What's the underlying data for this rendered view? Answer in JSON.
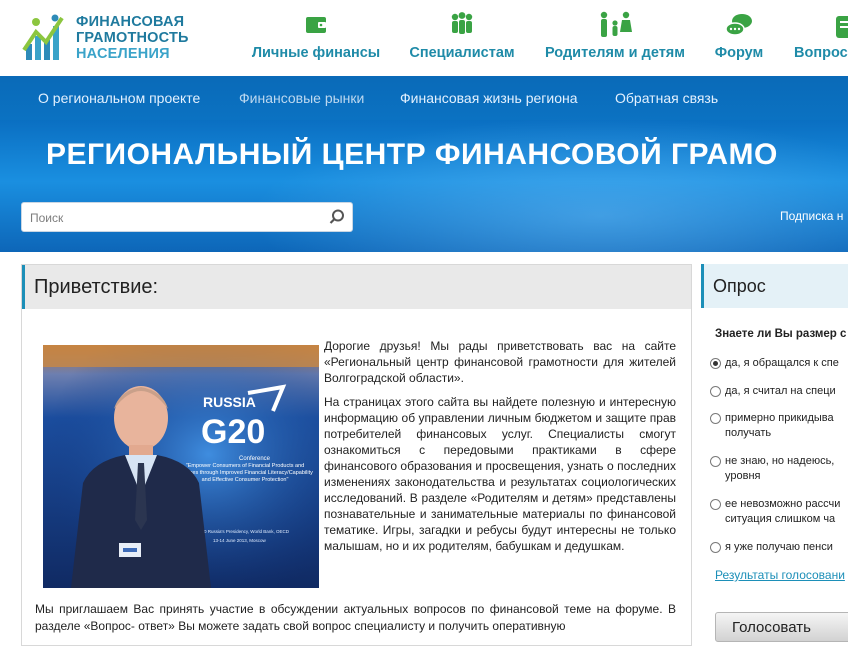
{
  "logo": {
    "line1": "ФИНАНСОВАЯ",
    "line2": "ГРАМОТНОСТЬ",
    "line3": "НАСЕЛЕНИЯ"
  },
  "top_nav": [
    {
      "label": "Личные финансы",
      "icon": "wallet-icon"
    },
    {
      "label": "Специалистам",
      "icon": "people-group-icon"
    },
    {
      "label": "Родителям и детям",
      "icon": "family-icon"
    },
    {
      "label": "Форум",
      "icon": "chat-bubbles-icon"
    },
    {
      "label": "Вопрос",
      "icon": "question-icon"
    }
  ],
  "sub_nav": [
    {
      "label": "О региональном проекте"
    },
    {
      "label": "Финансовые рынки"
    },
    {
      "label": "Финансовая жизнь региона"
    },
    {
      "label": "Обратная связь"
    }
  ],
  "banner": {
    "title": "РЕГИОНАЛЬНЫЙ ЦЕНТР ФИНАНСОВОЙ ГРАМО"
  },
  "search": {
    "placeholder": "Поиск"
  },
  "subscribe_label": "Подписка н",
  "greeting": {
    "title": "Приветствие:",
    "paragraphs": [
      "Дорогие друзья! Мы рады приветствовать вас на сайте «Региональный центр финансовой грамотности для жителей Волгоградской области».",
      "На страницах этого сайта вы найдете полезную и интересную информацию об управлении личным бюджетом и защите прав потребителей финансовых услуг. Специалисты смогут ознакомиться с передовыми практиками в сфере финансового образования и просвещения, узнать о последних изменениях законодательства и результатах социологических исследований. В разделе «Родителям и детям» представлены познавательные и занимательные материалы по финансовой тематике. Игры, загадки и ребусы будут интересны не только малышам, но и их родителям, бабушкам и дедушкам."
    ],
    "bottom_text": "Мы приглашаем Вас принять участие в обсуждении актуальных вопросов по финансовой теме на форуме. В разделе «Вопрос- ответ» Вы можете задать свой вопрос специалисту и получить оперативную",
    "photo": {
      "banner_word": "RUSSIA",
      "banner_logo": "G20",
      "banner_sub": "Conference",
      "banner_caption": "\"Empower Consumers of Financial Products and Services through Improved Financial Literacy/Capability and Effective Consumer Protection\"",
      "banner_small": "The G20 Russia's Presidency, World Bank, OECD",
      "banner_date": "13-14 June 2013, Moscow"
    }
  },
  "poll": {
    "title": "Опрос",
    "question": "Знаете ли Вы размер с",
    "options": [
      {
        "label": "да, я обращался к спе",
        "selected": true
      },
      {
        "label": "да, я считал на специ",
        "selected": false
      },
      {
        "label": "примерно прикидыва|получать",
        "line1": "примерно прикидыва",
        "line2": "получать",
        "selected": false
      },
      {
        "label": "не знаю, но надеюсь,",
        "line1": "не знаю, но надеюсь,",
        "line2": "уровня",
        "selected": false
      },
      {
        "label": "ее невозможно рассчи",
        "line1": "ее невозможно рассчи",
        "line2": "ситуация слишком ча",
        "selected": false
      },
      {
        "label": "я уже получаю пенси",
        "selected": false
      }
    ],
    "results_link": "Результаты голосовани",
    "vote_button": "Голосовать"
  },
  "colors": {
    "accent": "#1c8fb8",
    "banner_blue": "#0a6fc2",
    "nav_text": "#1f8ba8"
  }
}
